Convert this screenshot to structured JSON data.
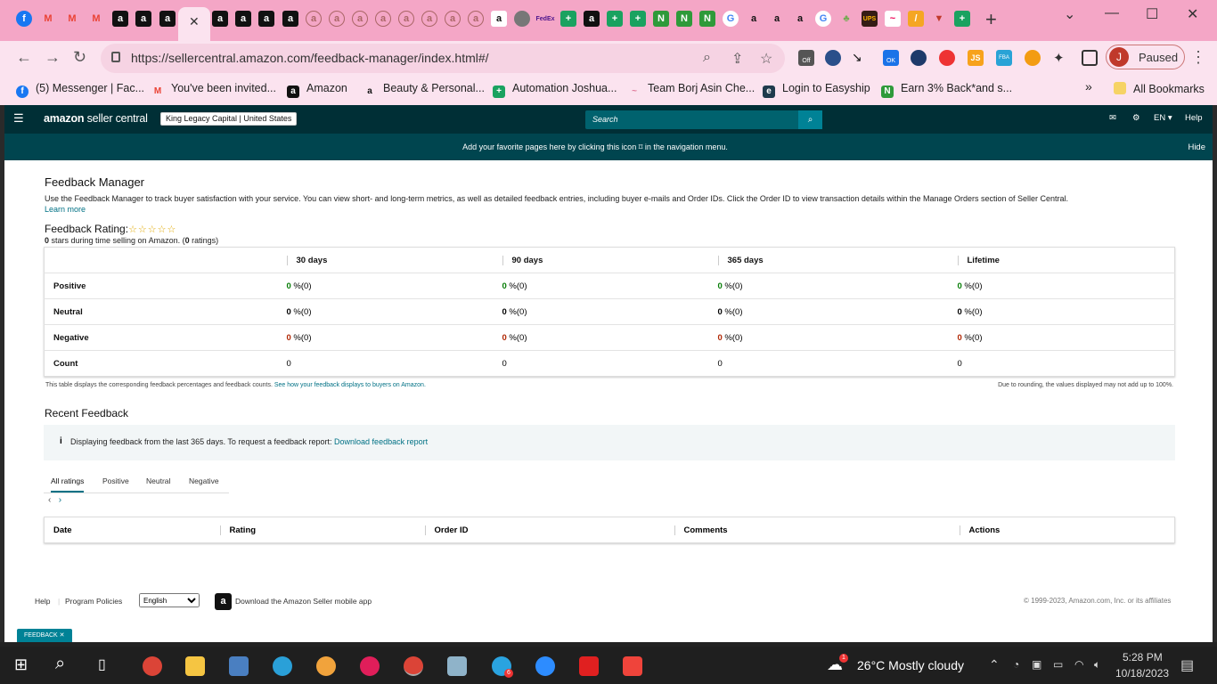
{
  "browser": {
    "url": "https://sellercentral.amazon.com/feedback-manager/index.html#/",
    "profile_initial": "J",
    "profile_status": "Paused",
    "ext_off_label": "Off",
    "ext_ok_label": "OK",
    "ext_js_label": "JS",
    "ext_fba_label": "FBA",
    "bookmarks": [
      {
        "label": "(5) Messenger | Fac...",
        "icon": "facebook-icon",
        "color": "#1877f2"
      },
      {
        "label": "You've been invited...",
        "icon": "gmail-icon",
        "color": "#ea4335"
      },
      {
        "label": "Amazon",
        "icon": "amazon-icon",
        "color": "#111111"
      },
      {
        "label": "Beauty & Personal...",
        "icon": "amazon-icon",
        "color": "#ffffff"
      },
      {
        "label": "Automation Joshua...",
        "icon": "sheets-icon",
        "color": "#1aa260"
      },
      {
        "label": "Team Borj Asin Che...",
        "icon": "chart-icon",
        "color": "#e07a9a"
      },
      {
        "label": "Login to Easyship",
        "icon": "easyship-icon",
        "color": "#1e3a4c"
      },
      {
        "label": "Earn 3% Back*and s...",
        "icon": "rakuten-icon",
        "color": "#2e9a3a"
      }
    ],
    "all_bookmarks": "All Bookmarks",
    "more_bookmarks": "»"
  },
  "header": {
    "logo_brand": "amazon",
    "logo_product": "seller central",
    "account": "King Legacy Capital | United States",
    "search_placeholder": "Search",
    "lang": "EN ▾",
    "help": "Help"
  },
  "favbar": {
    "message": "Add your favorite pages here by clicking this icon ⌑ in the navigation menu.",
    "hide": "Hide"
  },
  "main": {
    "title": "Feedback Manager",
    "description": "Use the Feedback Manager to track buyer satisfaction with your service. You can view short- and long-term metrics, as well as detailed feedback entries, including buyer e-mails and Order IDs. Click the Order ID to view transaction details within the Manage Orders section of Seller Central.",
    "learn_more": "Learn more",
    "rating_label": "Feedback Rating:",
    "stars": "☆☆☆☆☆",
    "rating_sub_pre": " stars during time selling on Amazon. (",
    "rating_stars_value": "0",
    "rating_count_value": "0",
    "rating_sub_post": " ratings)",
    "table": {
      "columns": [
        "30 days",
        "90 days",
        "365 days",
        "Lifetime"
      ],
      "rows": [
        {
          "label": "Positive",
          "cells": [
            "0",
            "0",
            "0",
            "0"
          ],
          "suffix": " %(0)"
        },
        {
          "label": "Neutral",
          "cells": [
            "0",
            "0",
            "0",
            "0"
          ],
          "suffix": " %(0)"
        },
        {
          "label": "Negative",
          "cells": [
            "0",
            "0",
            "0",
            "0"
          ],
          "suffix": " %(0)"
        },
        {
          "label": "Count",
          "cells": [
            "0",
            "0",
            "0",
            "0"
          ],
          "suffix": ""
        }
      ]
    },
    "table_note": "This table displays the corresponding feedback percentages and feedback counts.",
    "table_note_link": "See how your feedback displays to buyers on Amazon.",
    "rounding_note": "Due to rounding, the values displayed may not add up to 100%.",
    "recent_title": "Recent Feedback",
    "info_text": "Displaying feedback from the last 365 days. To request a feedback report:",
    "info_link": "Download feedback report",
    "filter_tabs": [
      "All ratings",
      "Positive",
      "Neutral",
      "Negative"
    ],
    "recent_columns": [
      "Date",
      "Rating",
      "Order ID",
      "Comments",
      "Actions"
    ]
  },
  "footer": {
    "help": "Help",
    "policies": "Program Policies",
    "language": "English",
    "app": "Download the Amazon Seller mobile app",
    "copyright": "© 1999-2023, Amazon.com, Inc. or its affiliates",
    "feedback_badge": "FEEDBACK ✕"
  },
  "taskbar": {
    "weather": "26°C  Mostly cloudy",
    "time": "5:28 PM",
    "date": "10/18/2023",
    "weather_badge": "1",
    "telegram_badge": "6"
  }
}
